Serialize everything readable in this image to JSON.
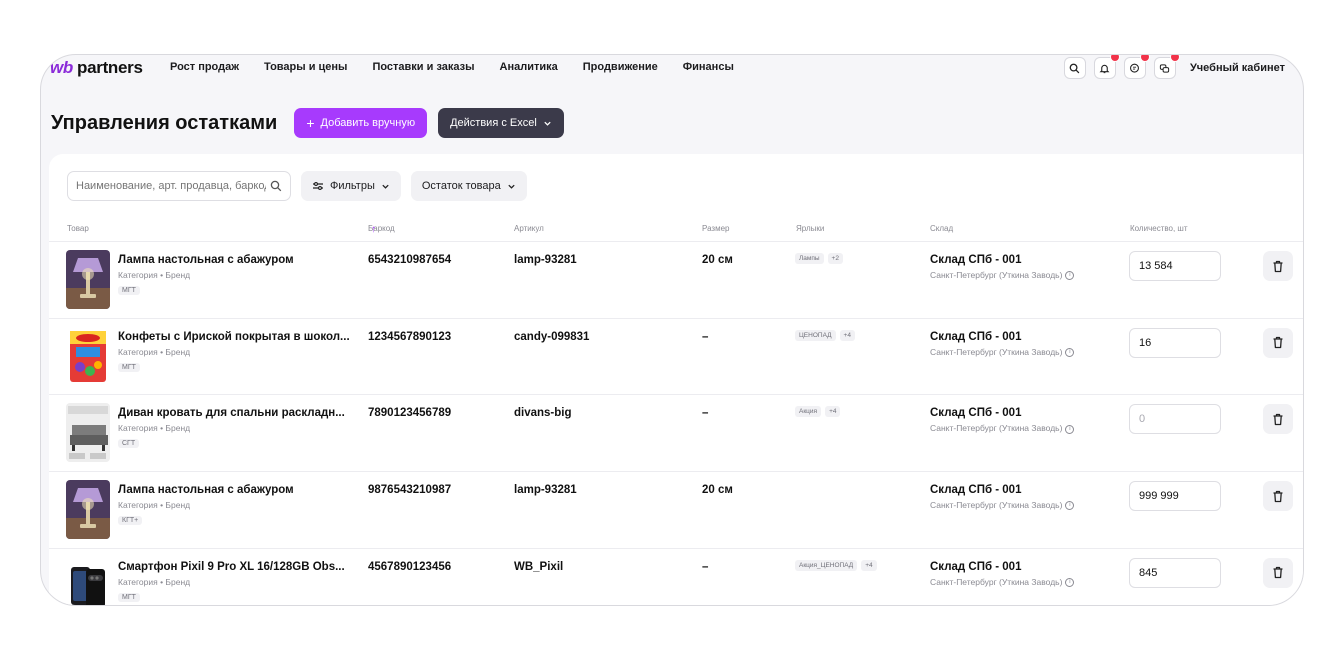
{
  "logo": {
    "prefix": "wb",
    "text": "partners"
  },
  "nav": [
    "Рост продаж",
    "Товары и цены",
    "Поставки и заказы",
    "Аналитика",
    "Продвижение",
    "Финансы"
  ],
  "nav_right": {
    "cabinet": "Учебный кабинет"
  },
  "page": {
    "title": "Управления остатками",
    "add_button": "Добавить вручную",
    "excel_button": "Действия с Excel"
  },
  "toolbar": {
    "search_placeholder": "Наименование, арт. продавца, баркод",
    "filters": "Фильтры",
    "stock": "Остаток товара"
  },
  "table": {
    "headers": {
      "product": "Товар",
      "barcode": "Баркод",
      "article": "Артикул",
      "size": "Размер",
      "labels": "Ярлыки",
      "warehouse": "Склад",
      "qty": "Количество, шт"
    },
    "rows": [
      {
        "name": "Лампа настольная с абажуром",
        "sub": "Категория • Бренд",
        "tag": "МГТ",
        "barcode": "6543210987654",
        "article": "lamp-93281",
        "size": "20 см",
        "label": "Лампы",
        "label_more": "+2",
        "warehouse": "Склад СПб - 001",
        "warehouse_sub": "Санкт-Петербург (Уткина Заводь)",
        "qty": "13 584",
        "thumb": "lamp"
      },
      {
        "name": "Конфеты с Ириской покрытая в шокол...",
        "sub": "Категория • Бренд",
        "tag": "МГТ",
        "barcode": "1234567890123",
        "article": "candy-099831",
        "size": "–",
        "label": "ЦЕНОПАД",
        "label_more": "+4",
        "warehouse": "Склад СПб - 001",
        "warehouse_sub": "Санкт-Петербург (Уткина Заводь)",
        "qty": "16",
        "thumb": "candy"
      },
      {
        "name": "Диван кровать для спальни раскладн...",
        "sub": "Категория • Бренд",
        "tag": "СГТ",
        "barcode": "7890123456789",
        "article": "divans-big",
        "size": "–",
        "label": "Акция",
        "label_more": "+4",
        "warehouse": "Склад СПб - 001",
        "warehouse_sub": "Санкт-Петербург (Уткина Заводь)",
        "qty": "",
        "qty_placeholder": "0",
        "thumb": "sofa"
      },
      {
        "name": "Лампа настольная с абажуром",
        "sub": "Категория • Бренд",
        "tag": "КГТ+",
        "barcode": "9876543210987",
        "article": "lamp-93281",
        "size": "20 см",
        "label": "",
        "label_more": "",
        "warehouse": "Склад СПб - 001",
        "warehouse_sub": "Санкт-Петербург (Уткина Заводь)",
        "qty": "999 999",
        "thumb": "lamp"
      },
      {
        "name": "Смартфон Pixil 9 Pro XL 16/128GB Obs...",
        "sub": "Категория • Бренд",
        "tag": "МГТ",
        "barcode": "4567890123456",
        "article": "WB_Pixil",
        "size": "–",
        "label": "Акция_ЦЕНОПАД",
        "label_more": "+4",
        "warehouse": "Склад СПб - 001",
        "warehouse_sub": "Санкт-Петербург (Уткина Заводь)",
        "qty": "845",
        "thumb": "phone"
      }
    ]
  },
  "colors": {
    "accent": "#a73afd",
    "dark_button": "#3b3a4a",
    "badge": "#f2334a",
    "page_bg": "#f6f6f9"
  }
}
